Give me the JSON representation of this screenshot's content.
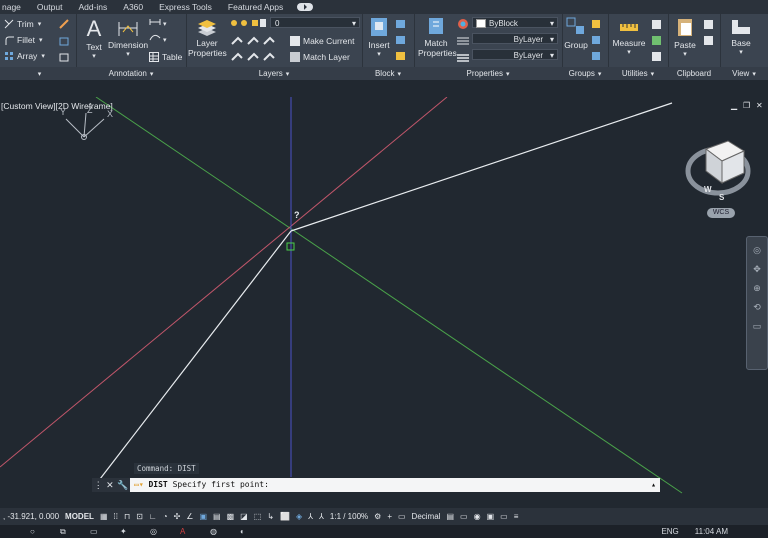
{
  "menubar": {
    "items": [
      "nage",
      "Output",
      "Add-ins",
      "A360",
      "Express Tools",
      "Featured Apps"
    ]
  },
  "ribbon": {
    "modify": {
      "trim": "Trim",
      "fillet": "Fillet",
      "array": "Array"
    },
    "annotation": {
      "text": "Text",
      "dimension": "Dimension",
      "table": "Table",
      "title": "Annotation"
    },
    "layers": {
      "properties_line1": "Layer",
      "properties_line2": "Properties",
      "layer_value": "0",
      "make_current": "Make Current",
      "match_layer": "Match Layer",
      "title": "Layers"
    },
    "block": {
      "insert": "Insert",
      "title": "Block"
    },
    "properties": {
      "match_line1": "Match",
      "match_line2": "Properties",
      "color": "ByBlock",
      "linetype": "ByLayer",
      "lineweight": "ByLayer",
      "title": "Properties"
    },
    "groups": {
      "group": "Group",
      "title": "Groups"
    },
    "utilities": {
      "measure": "Measure",
      "title": "Utilities"
    },
    "clipboard": {
      "paste": "Paste",
      "title": "Clipboard"
    },
    "view": {
      "base": "Base",
      "title": "View"
    }
  },
  "viewport": {
    "label": "[Custom View][2D Wireframe]",
    "ucs_x": "X",
    "ucs_y": "Y",
    "ucs_z": "Z",
    "cursor_tip": "?",
    "cube_w": "W",
    "cube_s": "S",
    "wcs": "WCS"
  },
  "command": {
    "history": "Command: DIST",
    "prompt_cmd": "DIST",
    "prompt_text": "Specify first point:"
  },
  "status": {
    "coords": ", -31.921, 0.000",
    "model": "MODEL",
    "scale": "1:1 / 100%",
    "units": "Decimal"
  },
  "taskbar": {
    "lang": "ENG",
    "time": "11:04 AM"
  },
  "colors": {
    "background": "#212830",
    "red_axis": "#c0566a",
    "green_axis": "#4aa24a",
    "blue_axis": "#4a52c8",
    "line": "#e8ecef"
  }
}
